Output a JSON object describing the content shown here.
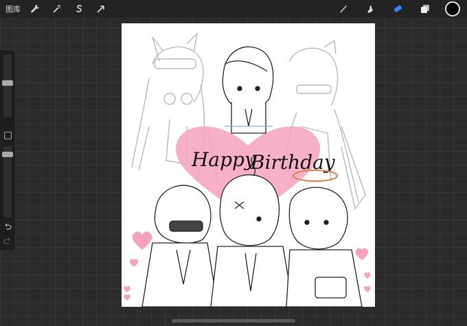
{
  "topbar": {
    "gallery_label": "图库",
    "left_tools": [
      {
        "icon": "wrench-icon",
        "name": "actions"
      },
      {
        "icon": "magic-wand-icon",
        "name": "adjustments"
      },
      {
        "icon": "selection-s-icon",
        "name": "selection"
      },
      {
        "icon": "arrow-cursor-icon",
        "name": "transform"
      }
    ],
    "right_tools": [
      {
        "icon": "brush-icon",
        "name": "brush"
      },
      {
        "icon": "smudge-icon",
        "name": "smudge"
      },
      {
        "icon": "eraser-icon",
        "name": "eraser",
        "active": true
      },
      {
        "icon": "layers-icon",
        "name": "layers"
      }
    ],
    "current_color": "#000000"
  },
  "canvas_text": {
    "happy": "Happy",
    "birthday": "Birthday"
  },
  "colors": {
    "accent_active": "#3b82f6",
    "heart_pink": "#f4a3bd",
    "halo": "#d9805a"
  }
}
